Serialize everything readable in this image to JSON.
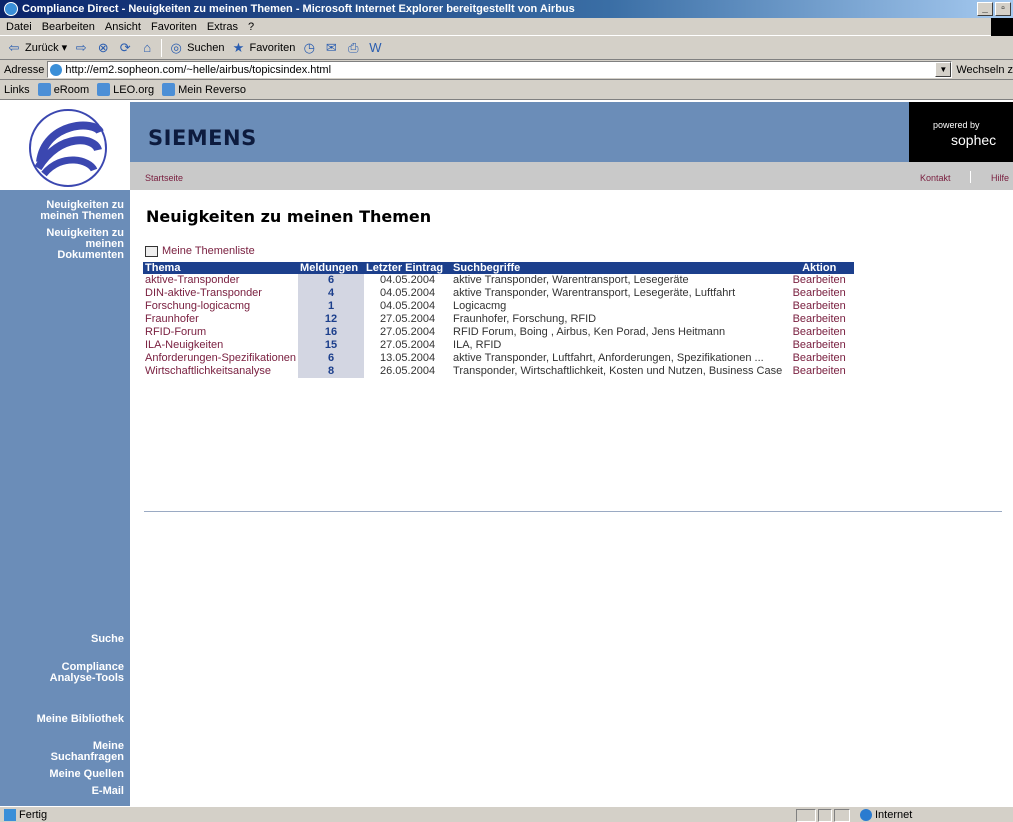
{
  "window": {
    "title": "Compliance Direct - Neuigkeiten zu meinen Themen - Microsoft Internet Explorer bereitgestellt von Airbus"
  },
  "menu": [
    "Datei",
    "Bearbeiten",
    "Ansicht",
    "Favoriten",
    "Extras",
    "?"
  ],
  "toolbar": {
    "back": "Zurück",
    "search": "Suchen",
    "favorites": "Favoriten"
  },
  "address": {
    "label": "Adresse",
    "url": "http://em2.sopheon.com/~helle/airbus/topicsindex.html",
    "goto": "Wechseln z"
  },
  "links": {
    "label": "Links",
    "items": [
      "eRoom",
      "LEO.org",
      "Mein Reverso"
    ]
  },
  "header": {
    "brand": "SIEMENS",
    "powered_by": "powered by",
    "sopheon": "sophec"
  },
  "subnav": {
    "home": "Startseite",
    "contact": "Kontakt",
    "help": "Hilfe"
  },
  "sidebar": {
    "news_topics": [
      "Neuigkeiten zu",
      "meinen Themen"
    ],
    "news_docs": [
      "Neuigkeiten zu",
      "meinen",
      "Dokumenten"
    ],
    "search": "Suche",
    "compliance": [
      "Compliance",
      "Analyse-Tools"
    ],
    "library": "Meine Bibliothek",
    "queries": [
      "Meine",
      "Suchanfragen"
    ],
    "sources": "Meine Quellen",
    "email": "E-Mail"
  },
  "main": {
    "title": "Neuigkeiten zu meinen Themen",
    "list_link": "Meine Themenliste",
    "columns": [
      "Thema",
      "Meldungen",
      "Letzter Eintrag",
      "Suchbegriffe",
      "Aktion"
    ],
    "rows": [
      {
        "topic": "aktive-Transponder",
        "count": "6",
        "date": "04.05.2004",
        "terms": "aktive Transponder, Warentransport, Lesegeräte",
        "action": "Bearbeiten"
      },
      {
        "topic": "DIN-aktive-Transponder",
        "count": "4",
        "date": "04.05.2004",
        "terms": "aktive Transponder, Warentransport, Lesegeräte, Luftfahrt",
        "action": "Bearbeiten"
      },
      {
        "topic": "Forschung-logicacmg",
        "count": "1",
        "date": "04.05.2004",
        "terms": "Logicacmg",
        "action": "Bearbeiten"
      },
      {
        "topic": "Fraunhofer",
        "count": "12",
        "date": "27.05.2004",
        "terms": "Fraunhofer, Forschung, RFID",
        "action": "Bearbeiten"
      },
      {
        "topic": "RFID-Forum",
        "count": "16",
        "date": "27.05.2004",
        "terms": "RFID Forum, Boing , Airbus, Ken Porad, Jens Heitmann",
        "action": "Bearbeiten"
      },
      {
        "topic": "ILA-Neuigkeiten",
        "count": "15",
        "date": "27.05.2004",
        "terms": "ILA, RFID",
        "action": "Bearbeiten"
      },
      {
        "topic": "Anforderungen-Spezifikationen",
        "count": "6",
        "date": "13.05.2004",
        "terms": "aktive Transponder, Luftfahrt, Anforderungen, Spezifikationen ...",
        "action": "Bearbeiten"
      },
      {
        "topic": "Wirtschaftlichkeitsanalyse",
        "count": "8",
        "date": "26.05.2004",
        "terms": "Transponder, Wirtschaftlichkeit, Kosten und Nutzen, Business Case",
        "action": "Bearbeiten"
      }
    ]
  },
  "status": {
    "text": "Fertig",
    "zone": "Internet"
  }
}
